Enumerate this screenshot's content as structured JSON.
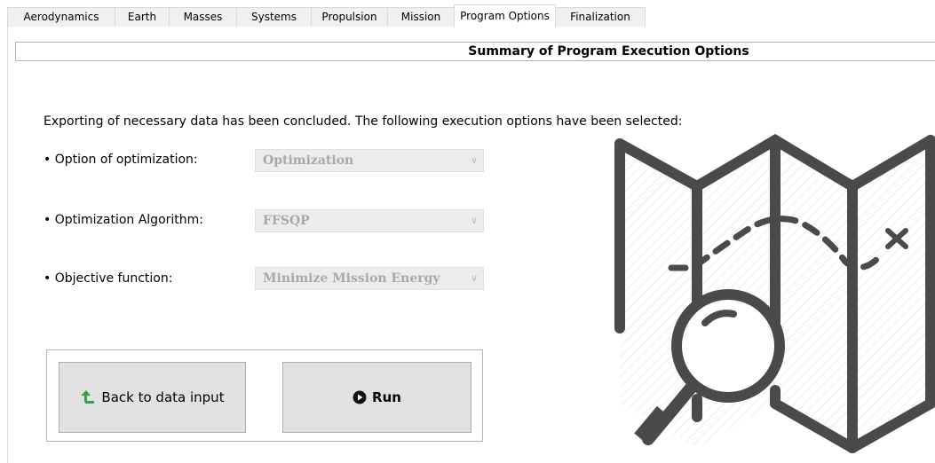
{
  "tabs": [
    {
      "label": "Aerodynamics",
      "width": 122
    },
    {
      "label": "Earth",
      "width": 62
    },
    {
      "label": "Masses",
      "width": 77
    },
    {
      "label": "Systems",
      "width": 85
    },
    {
      "label": "Propulsion",
      "width": 87
    },
    {
      "label": "Mission",
      "width": 76
    },
    {
      "label": "Program Options",
      "width": 115,
      "active": true
    },
    {
      "label": "Finalization",
      "width": 102
    }
  ],
  "header": {
    "title": "Summary of Program Execution Options"
  },
  "intro": "Exporting of necessary data has been concluded. The following execution options have been selected:",
  "options": [
    {
      "label": "• Option of optimization:",
      "value": "Optimization"
    },
    {
      "label": "• Optimization Algorithm:",
      "value": "FFSQP"
    },
    {
      "label": "• Objective function:",
      "value": "Minimize Mission Energy"
    }
  ],
  "buttons": {
    "back": {
      "label": "Back to data input",
      "icon": "green-up-left-arrow-icon"
    },
    "run": {
      "label": "Run",
      "icon": "play-circle-icon"
    }
  },
  "illustration": {
    "icon": "map-magnifier-icon",
    "color": "#4a4a4a"
  }
}
